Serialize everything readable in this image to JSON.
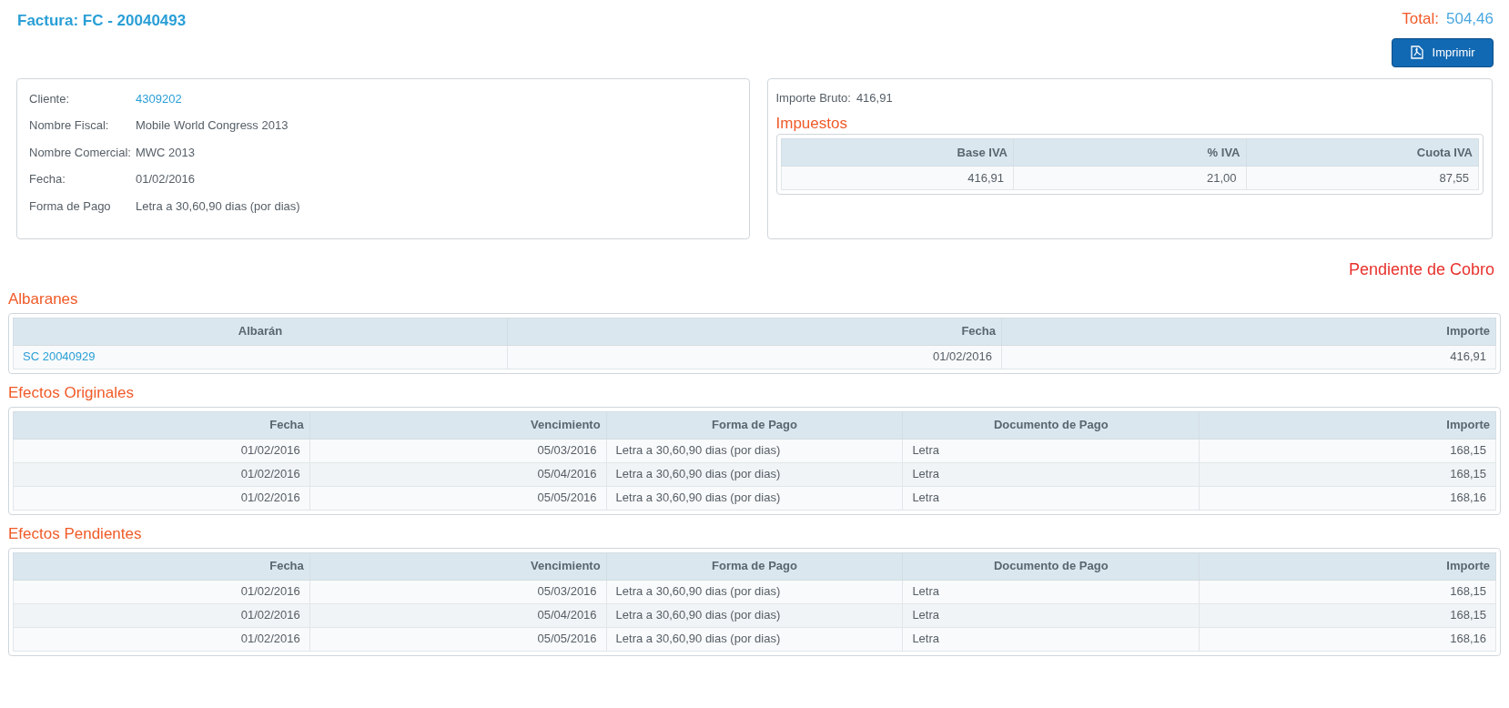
{
  "title": "Factura: FC - 20040493",
  "total": {
    "label": "Total:",
    "value": "504,46"
  },
  "print_button": {
    "label": "Imprimir"
  },
  "client_info": [
    {
      "label": "Cliente:",
      "value": "4309202",
      "kind": "link"
    },
    {
      "label": "Nombre Fiscal:",
      "value": "Mobile World Congress 2013",
      "kind": "text"
    },
    {
      "label": "Nombre Comercial:",
      "value": "MWC 2013",
      "kind": "text"
    },
    {
      "label": "Fecha:",
      "value": "01/02/2016",
      "kind": "text"
    },
    {
      "label": "Forma de Pago",
      "value": "Letra a 30,60,90 dias (por dias)",
      "kind": "text"
    }
  ],
  "importe_bruto": {
    "label": "Importe Bruto:",
    "value": "416,91"
  },
  "impuestos": {
    "title": "Impuestos",
    "columns": [
      "Base IVA",
      "% IVA",
      "Cuota IVA"
    ],
    "rows": [
      [
        "416,91",
        "21,00",
        "87,55"
      ]
    ]
  },
  "pending_label": "Pendiente de Cobro",
  "albaranes": {
    "title": "Albaranes",
    "columns": [
      "Albarán",
      "Fecha",
      "Importe"
    ],
    "rows": [
      [
        "SC 20040929",
        "01/02/2016",
        "416,91"
      ]
    ]
  },
  "efectos_originales": {
    "title": "Efectos Originales",
    "columns": [
      "Fecha",
      "Vencimiento",
      "Forma de Pago",
      "Documento de Pago",
      "Importe"
    ],
    "rows": [
      [
        "01/02/2016",
        "05/03/2016",
        "Letra a 30,60,90 dias (por dias)",
        "Letra",
        "168,15"
      ],
      [
        "01/02/2016",
        "05/04/2016",
        "Letra a 30,60,90 dias (por dias)",
        "Letra",
        "168,15"
      ],
      [
        "01/02/2016",
        "05/05/2016",
        "Letra a 30,60,90 dias (por dias)",
        "Letra",
        "168,16"
      ]
    ]
  },
  "efectos_pendientes": {
    "title": "Efectos Pendientes",
    "columns": [
      "Fecha",
      "Vencimiento",
      "Forma de Pago",
      "Documento de Pago",
      "Importe"
    ],
    "rows": [
      [
        "01/02/2016",
        "05/03/2016",
        "Letra a 30,60,90 dias (por dias)",
        "Letra",
        "168,15"
      ],
      [
        "01/02/2016",
        "05/04/2016",
        "Letra a 30,60,90 dias (por dias)",
        "Letra",
        "168,15"
      ],
      [
        "01/02/2016",
        "05/05/2016",
        "Letra a 30,60,90 dias (por dias)",
        "Letra",
        "168,16"
      ]
    ]
  }
}
